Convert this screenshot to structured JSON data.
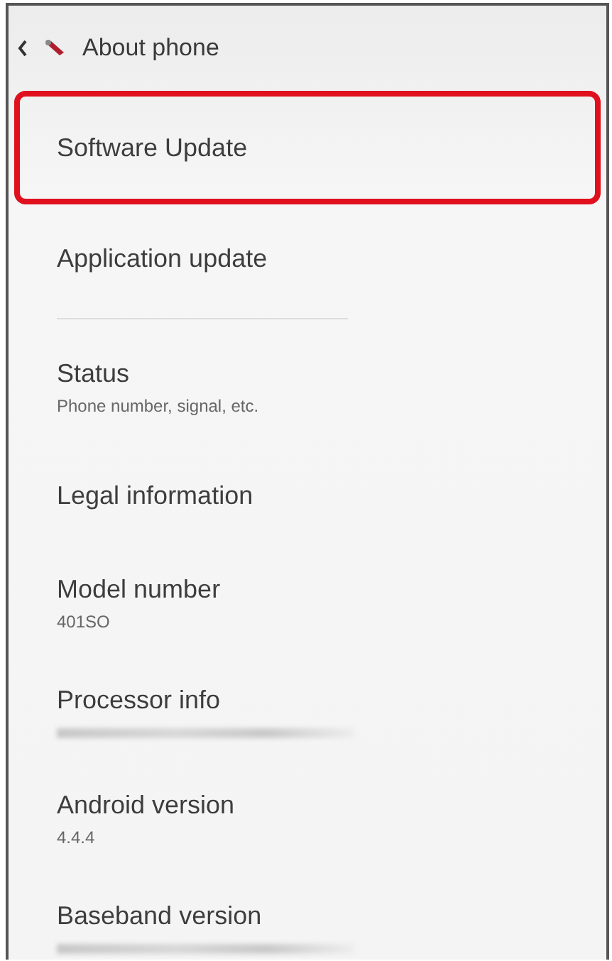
{
  "header": {
    "title": "About phone"
  },
  "items": [
    {
      "kind": "single",
      "title": "Software Update",
      "highlighted": true,
      "divider": false
    },
    {
      "kind": "single",
      "title": "Application update",
      "highlighted": false,
      "divider": true
    },
    {
      "kind": "double",
      "title": "Status",
      "summary": "Phone number, signal, etc.",
      "highlighted": false,
      "divider": false
    },
    {
      "kind": "single",
      "title": "Legal information",
      "highlighted": false,
      "divider": false
    },
    {
      "kind": "double",
      "title": "Model number",
      "summary": "401SO",
      "highlighted": false,
      "divider": false
    },
    {
      "kind": "redacted",
      "title": "Processor info",
      "highlighted": false,
      "divider": false
    },
    {
      "kind": "double",
      "title": "Android version",
      "summary": "4.4.4",
      "highlighted": false,
      "divider": false
    },
    {
      "kind": "redacted",
      "title": "Baseband version",
      "highlighted": false,
      "divider": false
    }
  ]
}
